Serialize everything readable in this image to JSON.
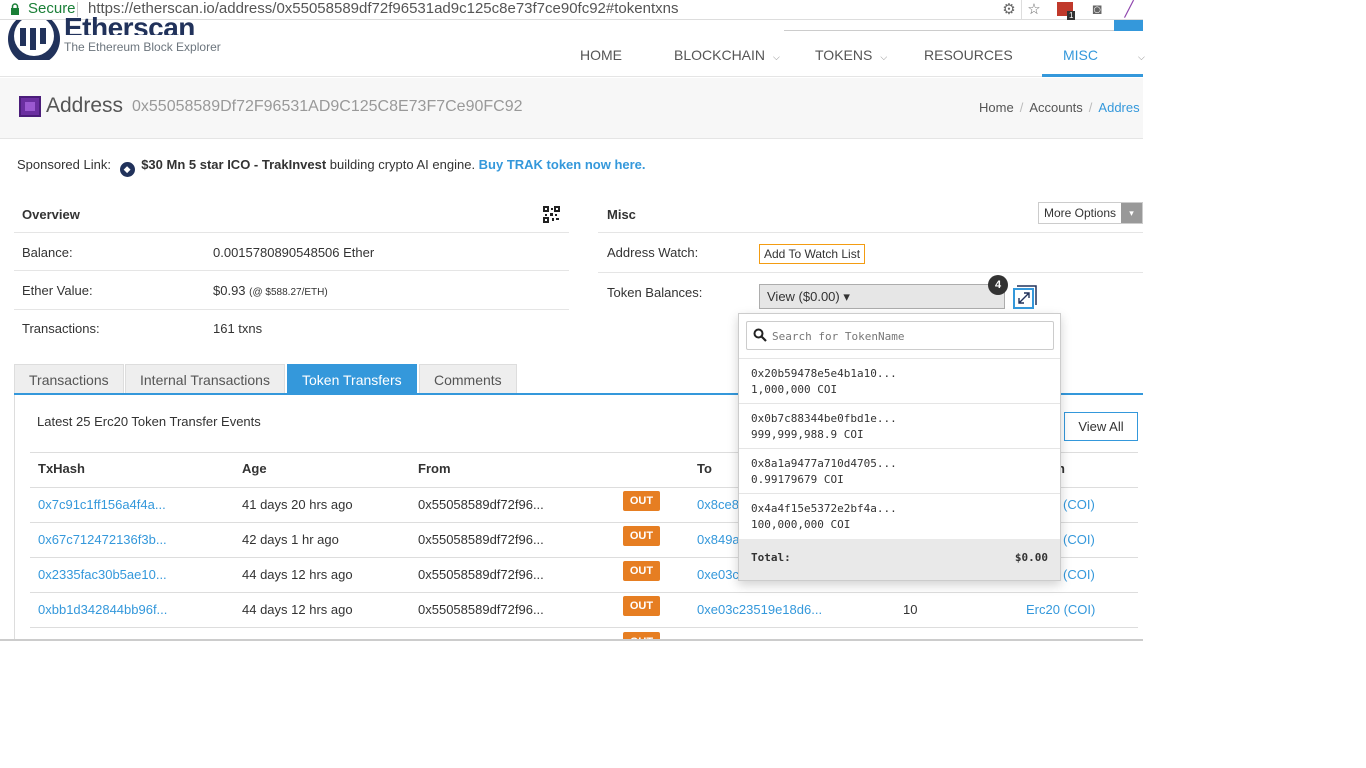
{
  "browser": {
    "secure_label": "Secure",
    "url": "https://etherscan.io/address/0x55058589df72f96531ad9c125c8e73f7ce90fc92#tokentxns",
    "ext_badge": "1"
  },
  "header": {
    "logo_text": "Etherscan",
    "logo_sub": "The Ethereum Block Explorer",
    "nav": [
      {
        "label": "HOME"
      },
      {
        "label": "BLOCKCHAIN"
      },
      {
        "label": "TOKENS"
      },
      {
        "label": "RESOURCES"
      },
      {
        "label": "MISC"
      }
    ]
  },
  "address_bar": {
    "title": "Address",
    "hash": "0x55058589Df72F96531AD9C125C8E73F7Ce90FC92",
    "breadcrumbs": [
      "Home",
      "Accounts",
      "Addres"
    ]
  },
  "sponsored": {
    "label": "Sponsored Link:",
    "headline": "$30 Mn 5 star ICO - TrakInvest",
    "text": " building crypto AI engine. ",
    "link": "Buy TRAK token now here."
  },
  "overview": {
    "title": "Overview",
    "balance_label": "Balance:",
    "balance_value": "0.0015780890548506 Ether",
    "ether_value_label": "Ether Value:",
    "ether_value": "$0.93",
    "ether_rate": "(@ $588.27/ETH)",
    "transactions_label": "Transactions:",
    "transactions_value": "161 txns"
  },
  "misc": {
    "title": "Misc",
    "more_options": "More Options",
    "watch_label": "Address Watch:",
    "watch_button": "Add To Watch List",
    "token_label": "Token Balances:",
    "token_view": "View ($0.00) ▾",
    "token_count": "4"
  },
  "tabs": [
    "Transactions",
    "Internal Transactions",
    "Token Transfers",
    "Comments"
  ],
  "active_tab": "Token Transfers",
  "transfers": {
    "heading": "Latest 25 Erc20 Token Transfer Events",
    "view_all": "View All",
    "columns": [
      "TxHash",
      "Age",
      "From",
      "To",
      "n"
    ],
    "rows": [
      {
        "hash": "0x7c91c1ff156a4f4a...",
        "age": "41 days 20 hrs ago",
        "from": "0x55058589df72f96...",
        "dir": "OUT",
        "to": "0x8ce8",
        "value": "",
        "token": "(COI)"
      },
      {
        "hash": "0x67c712472136f3b...",
        "age": "42 days 1 hr ago",
        "from": "0x55058589df72f96...",
        "dir": "OUT",
        "to": "0x849a",
        "value": "",
        "token": "(COI)"
      },
      {
        "hash": "0x2335fac30b5ae10...",
        "age": "44 days 12 hrs ago",
        "from": "0x55058589df72f96...",
        "dir": "OUT",
        "to": "0xe03c",
        "value": "",
        "token": "(COI)"
      },
      {
        "hash": "0xbb1d342844bb96f...",
        "age": "44 days 12 hrs ago",
        "from": "0x55058589df72f96...",
        "dir": "OUT",
        "to": "0xe03c23519e18d6...",
        "value": "10",
        "token": "Erc20 (COI)"
      }
    ]
  },
  "token_dropdown": {
    "search_placeholder": "Search for TokenName",
    "items": [
      {
        "address": "0x20b59478e5e4b1a10...",
        "amount": "1,000,000 COI"
      },
      {
        "address": "0x0b7c88344be0fbd1e...",
        "amount": "999,999,988.9 COI"
      },
      {
        "address": "0x8a1a9477a710d4705...",
        "amount": "0.99179679 COI"
      },
      {
        "address": "0x4a4f15e5372e2bf4a...",
        "amount": "100,000,000 COI"
      }
    ],
    "total_label": "Total:",
    "total_value": "$0.00"
  },
  "colors": {
    "accent": "#3498db",
    "out_badge": "#e67e22",
    "brand": "#21325b"
  }
}
